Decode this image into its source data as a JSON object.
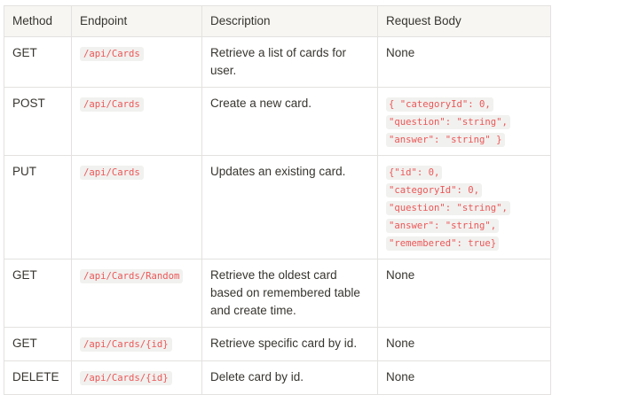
{
  "table": {
    "headers": [
      "Method",
      "Endpoint",
      "Description",
      "Request Body"
    ],
    "rows": [
      {
        "method": "GET",
        "endpoint": "/api/Cards",
        "description": "Retrieve a list of cards for user.",
        "body_plain": "None",
        "body_code": []
      },
      {
        "method": "POST",
        "endpoint": "/api/Cards",
        "description": "Create a new card.",
        "body_plain": "",
        "body_code": [
          "{ \"categoryId\": 0,",
          "\"question\": \"string\",",
          "\"answer\": \"string\" }"
        ]
      },
      {
        "method": "PUT",
        "endpoint": "/api/Cards",
        "description": "Updates an existing card.",
        "body_plain": "",
        "body_code": [
          "{\"id\": 0,",
          "\"categoryId\": 0,",
          "\"question\": \"string\",",
          "\"answer\": \"string\",",
          "\"remembered\": true}"
        ]
      },
      {
        "method": "GET",
        "endpoint": "/api/Cards/Random",
        "description": "Retrieve the oldest card based on remembered table and create time.",
        "body_plain": "None",
        "body_code": []
      },
      {
        "method": "GET",
        "endpoint": "/api/Cards/{id}",
        "description": "Retrieve specific card by id.",
        "body_plain": "None",
        "body_code": []
      },
      {
        "method": "DELETE",
        "endpoint": "/api/Cards/{id}",
        "description": "Delete card by id.",
        "body_plain": "None",
        "body_code": []
      }
    ]
  },
  "colors": {
    "text": "#37352f",
    "header_bg": "#f7f6f3",
    "border": "#e3e2e0",
    "code_text": "#eb5757",
    "code_bg": "#f1f1ef"
  }
}
